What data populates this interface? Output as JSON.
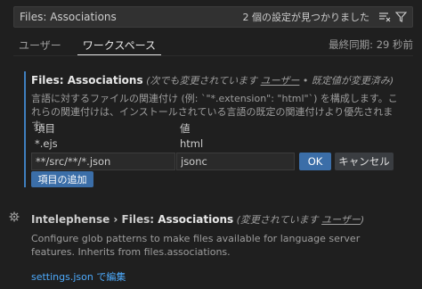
{
  "search": {
    "query": "Files: Associations",
    "result_count": "2 個の設定が見つかりました"
  },
  "tabs": {
    "user": "ユーザー",
    "workspace": "ワークスペース",
    "last_synced": "最終同期: 29 秒前"
  },
  "setting1": {
    "category": "Files: ",
    "name": "Associations",
    "meta_prefix": " (次でも変更されています ",
    "meta_link": "ユーザー",
    "meta_suffix": " • 既定値が変更済み)",
    "description": "言語に対するファイルの関連付け (例: `\"*.extension\": \"html\"`) を構成します。これらの関連付けは、インストールされている言語の既定の関連付けより優先されます。",
    "table": {
      "col_item": "項目",
      "col_value": "値",
      "rows": [
        {
          "item": "*.ejs",
          "value": "html"
        }
      ],
      "edit_item": "**/src/**/*.json",
      "edit_value": "jsonc"
    },
    "ok_label": "OK",
    "cancel_label": "キャンセル",
    "add_label": "項目の追加"
  },
  "setting2": {
    "category": "Intelephense › Files: ",
    "name": "Associations",
    "meta_prefix": " (変更されています ",
    "meta_link": "ユーザー",
    "meta_suffix": ")",
    "description": "Configure glob patterns to make files available for language server features. Inherits from files.associations.",
    "edit_link": "settings.json で編集"
  },
  "colors": {
    "accent": "#3b6ea8",
    "link": "#4daafc",
    "focus_bar": "#3f7fbf"
  }
}
